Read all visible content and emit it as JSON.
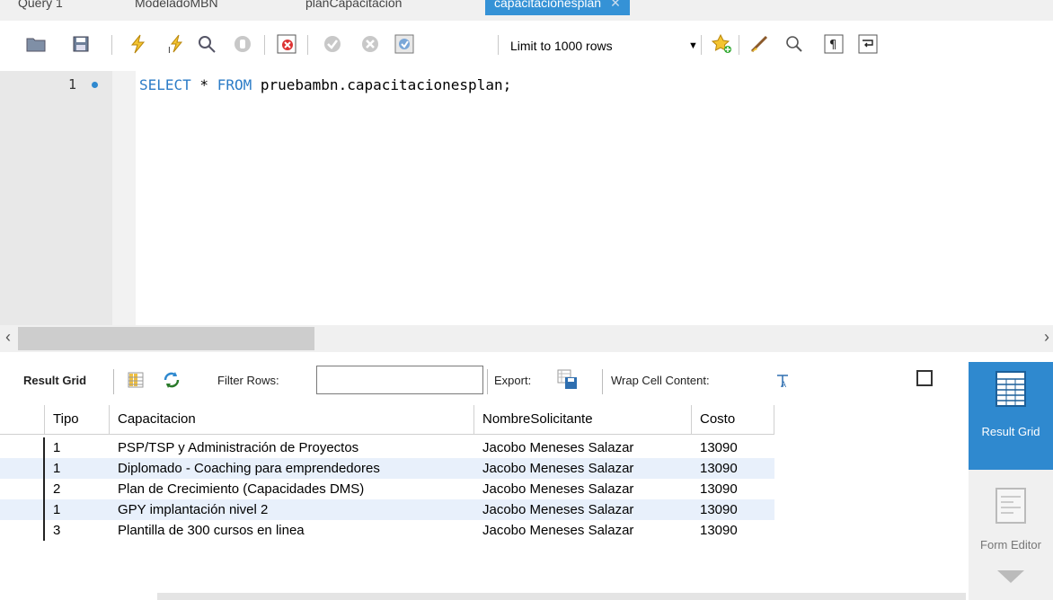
{
  "tabs": [
    {
      "label": "Query 1",
      "active": false
    },
    {
      "label": "ModeladoMBN",
      "active": false
    },
    {
      "label": "planCapacitacion",
      "active": false
    },
    {
      "label": "capacitacionesplan",
      "active": true
    }
  ],
  "toolbar": {
    "limit_label": "Limit to 1000 rows"
  },
  "editor": {
    "line_number": "1",
    "code_kw1": "SELECT",
    "code_star": " * ",
    "code_kw2": "FROM",
    "code_rest": " pruebambn.capacitacionesplan;"
  },
  "result_toolbar": {
    "result_grid_label": "Result Grid",
    "filter_label": "Filter Rows:",
    "filter_value": "",
    "export_label": "Export:",
    "wrap_label": "Wrap Cell Content:"
  },
  "grid": {
    "columns": [
      "Tipo",
      "Capacitacion",
      "NombreSolicitante",
      "Costo"
    ],
    "rows": [
      [
        "1",
        "PSP/TSP y Administración de Proyectos",
        "Jacobo Meneses Salazar",
        "13090"
      ],
      [
        "1",
        "Diplomado - Coaching para emprendedores",
        "Jacobo Meneses Salazar",
        "13090"
      ],
      [
        "2",
        "Plan de Crecimiento (Capacidades DMS)",
        "Jacobo Meneses Salazar",
        "13090"
      ],
      [
        "1",
        "GPY implantación nivel 2",
        "Jacobo Meneses Salazar",
        "13090"
      ],
      [
        "3",
        "Plantilla de 300 cursos en linea",
        "Jacobo Meneses Salazar",
        "13090"
      ]
    ]
  },
  "side_panel": {
    "result_grid_label": "Result Grid",
    "form_editor_label": "Form Editor"
  },
  "colors": {
    "accent": "#2f89cf",
    "keyword": "#2c7cc7",
    "row_alt": "#e8f0fb"
  }
}
